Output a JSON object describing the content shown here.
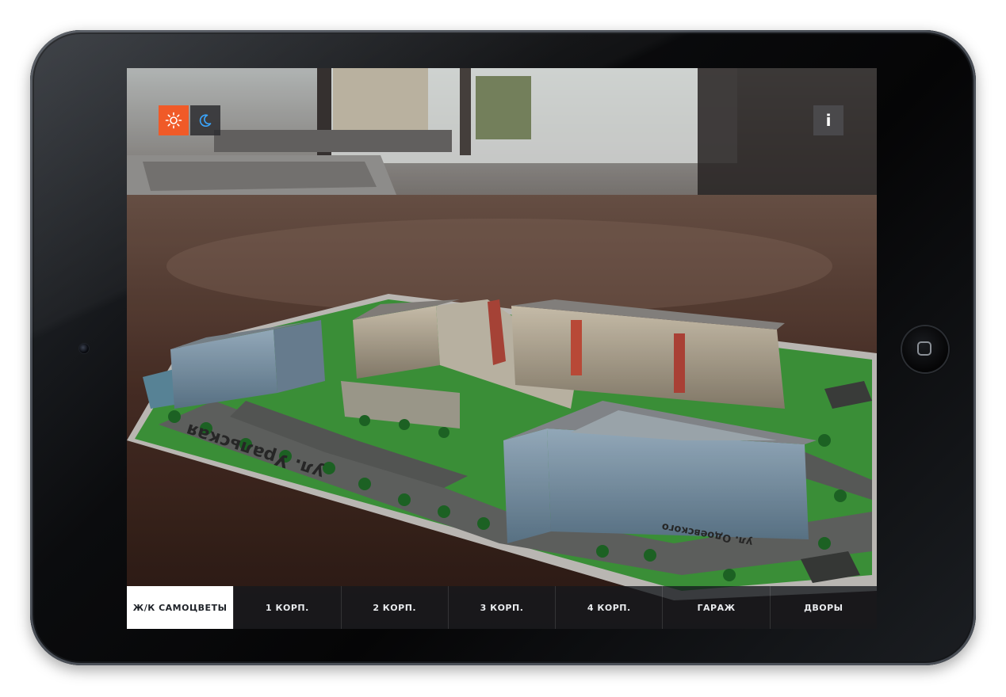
{
  "toolbar": {
    "sun_icon": "sun-icon",
    "moon_icon": "moon-icon",
    "info_label": "i",
    "sun_color": "#f05a28"
  },
  "tabs": [
    {
      "label": "Ж/К САМОЦВЕТЫ",
      "active": true
    },
    {
      "label": "1 КОРП.",
      "active": false
    },
    {
      "label": "2 КОРП.",
      "active": false
    },
    {
      "label": "3 КОРП.",
      "active": false
    },
    {
      "label": "4 КОРП.",
      "active": false
    },
    {
      "label": "ГАРАЖ",
      "active": false
    },
    {
      "label": "ДВОРЫ",
      "active": false
    }
  ],
  "map_labels": {
    "street_1": "ул. Уральская",
    "street_2": "ул. Одоевского"
  }
}
